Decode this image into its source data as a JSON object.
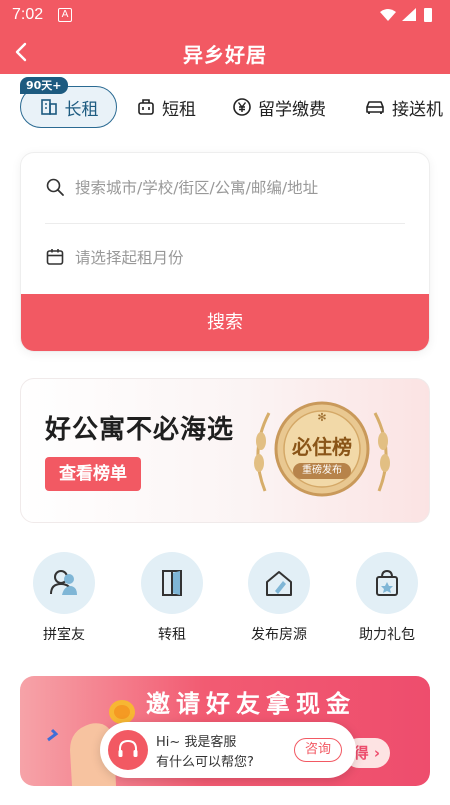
{
  "status": {
    "time": "7:02",
    "notification_icon": "A"
  },
  "nav": {
    "title": "异乡好居"
  },
  "tabs": [
    {
      "label": "长租",
      "badge": "90天+",
      "icon": "building-icon",
      "active": true
    },
    {
      "label": "短租",
      "icon": "suitcase-icon"
    },
    {
      "label": "留学缴费",
      "icon": "yen-icon"
    },
    {
      "label": "接送机",
      "icon": "car-icon"
    }
  ],
  "search": {
    "location_placeholder": "搜索城市/学校/街区/公寓/邮编/地址",
    "date_placeholder": "请选择起租月份",
    "button_label": "搜索"
  },
  "banner": {
    "headline": "好公寓不必海选",
    "cta": "查看榜单",
    "medal_title": "必住榜",
    "medal_subtitle": "重磅发布"
  },
  "actions": [
    {
      "label": "拼室友",
      "icon": "roommate-icon"
    },
    {
      "label": "转租",
      "icon": "door-icon"
    },
    {
      "label": "发布房源",
      "icon": "house-edit-icon"
    },
    {
      "label": "助力礼包",
      "icon": "gift-bag-icon"
    }
  ],
  "invite": {
    "title": "邀请好友拿现金",
    "button": "得"
  },
  "customer_service": {
    "line1": "Hi~ 我是客服",
    "line2": "有什么可以帮您?",
    "button": "咨询"
  },
  "colors": {
    "brand": "#f25963",
    "accent_blue": "#1d5b80"
  }
}
